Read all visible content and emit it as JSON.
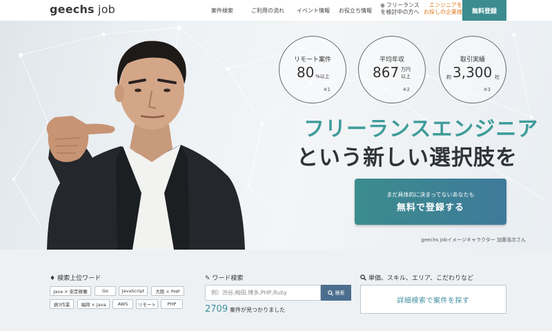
{
  "header": {
    "logo_main": "geechs",
    "logo_sub": " job",
    "nav": {
      "jobs": "案件検索",
      "flow": "ご利用の流れ",
      "events": "イベント情報",
      "tips": "お役立ち情報",
      "freelance_line1": "フリーランス",
      "freelance_line2": "を検討中の方へ",
      "company_line1": "エンジニアを",
      "company_line2": "お探しの企業様へ"
    },
    "signup": "無料登録"
  },
  "hero": {
    "stats": [
      {
        "label": "リモート案件",
        "prefix": "",
        "value": "80",
        "unit": "%以上",
        "note": "※1"
      },
      {
        "label": "平均年収",
        "prefix": "",
        "value": "867",
        "unit1": "万円",
        "unit2": "以上",
        "note": "※2"
      },
      {
        "label": "取引実績",
        "prefix": "約",
        "value": "3,300",
        "unit": "社",
        "note": "※3"
      }
    ],
    "catch_line1": "フリーランスエンジニア",
    "catch_line2": "という新しい選択肢を",
    "cta_sub": "まだ具体的に決まってないあなたも",
    "cta_main": "無料で登録する",
    "caption": "geechs jobイメージキャラクター 加藤浩次さん",
    "colors": {
      "accent": "#3f9c9a",
      "cta_start": "#3c8c8e",
      "cta_end": "#3e7a9a"
    }
  },
  "search": {
    "popular_title": "検索上位ワード",
    "tags": [
      "Java × 安定稼働",
      "Go",
      "JavaScript",
      "大阪 × PHP",
      "週3作業",
      "福岡 × Java",
      "AWS",
      "リモート",
      "PHP"
    ],
    "word_title": "ワード検索",
    "placeholder": "例）渋谷,梅田,博多,PHP,Ruby",
    "button": "検索",
    "result_count": "2709",
    "result_text": "案件が見つかりました",
    "detail_title": "単価、スキル、エリア、こだわりなど",
    "detail_button": "詳細検索で案件を探す"
  },
  "icons": [
    "tag-icon",
    "pencil-icon",
    "search-icon",
    "lightbulb-icon"
  ]
}
